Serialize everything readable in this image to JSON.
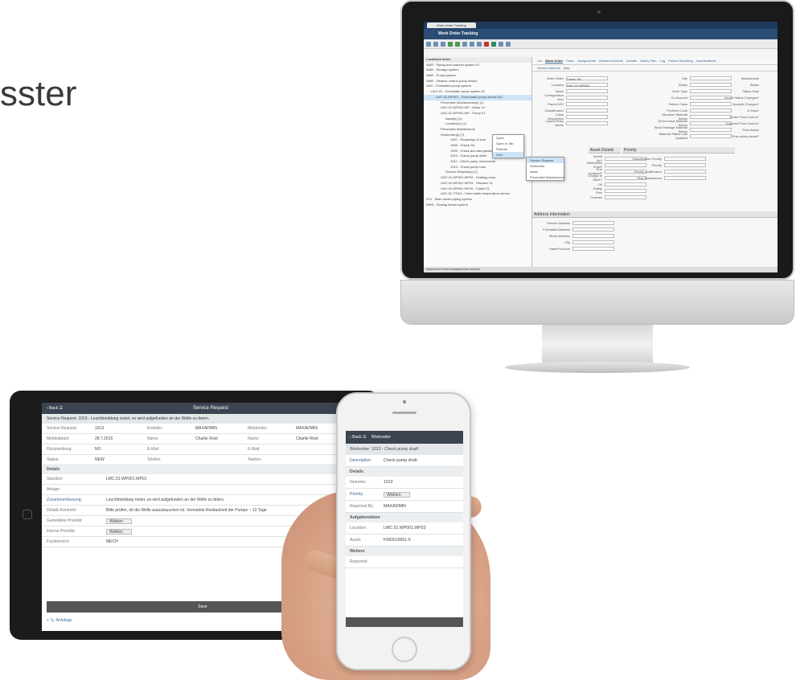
{
  "headline": "sster",
  "monitor": {
    "browser_tab": "Work Order Tracking",
    "app_title": "Work Order Tracking",
    "tree_title": "Locations Items",
    "tree_items": [
      "WAR - Piping and channel system 01",
      "WAR - Storage system",
      "WAR - Pump system",
      "WAR - Reactor control pump device",
      "LWC - Feedwater pump system",
      "LWC.01 - Feedwater pump system 01",
      "LWC.01.WP001 - Feed water pump device 001",
      "Preventive Maintenance(s) (1)",
      "LWC.01.WP001.WP - Motor 01",
      "LWC.01.WP001.WP - Pump 01",
      "Asset(s) (1)",
      "Location(s) (1)",
      "Preventive Maintenance",
      "Workorder(s) (7)",
      "1007 - Replacing oil seal",
      "1008 - Check Oil",
      "1009 - Check and add grease",
      "1010 - Check pump shaft",
      "1011 - Check pump mechanical",
      "1013 - Check pump rotor",
      "Service Request(s) (1)",
      "LWC.01.WP001.WP03 - Sealing pump",
      "LWC.01.WP001.WP04 - Gearbox 01",
      "LWC.01.WP001.WP05 - Clutch 01",
      "LWC.01.TT001 - Feed water temperature sensor",
      "LR1 - Main steam piping system",
      "RWS - Sealing steam system"
    ],
    "tabs": [
      "List",
      "Work Order",
      "Plans",
      "Assignments",
      "Related Records",
      "Actuals",
      "Safety Plan",
      "Log",
      "Failure Reporting",
      "Specifications"
    ],
    "subtabs": [
      "Service Address",
      "Map"
    ],
    "form_labels": [
      "Work Order",
      "Location",
      "Asset",
      "Configuration Item",
      "Parent WO",
      "Classification",
      "Class Description",
      "Layout Entry Name"
    ],
    "form_values": [
      "1026",
      "Check Oil",
      "LWC.01.WP001",
      "Feed pump"
    ],
    "right_labels": [
      "Site",
      "Status",
      "Work Type",
      "GL Account",
      "Failure Class",
      "Problem Code",
      "Structure Material Status",
      "Direct Issue Material Status",
      "Work Package Material Status",
      "Material Status Last Updated"
    ],
    "status_labels": [
      "Attachments",
      "Status",
      "Status Date",
      "Inherit Status Changes?",
      "Accepts Charges?",
      "Is Task?",
      "Under Flow Control?",
      "Suspend Flow Control?",
      "Flow Action",
      "Flow action Assist?"
    ],
    "context_menu": [
      "Open",
      "Open in Tab",
      "Refresh",
      "New"
    ],
    "submenu": [
      "Service Request",
      "Workorder",
      "Asset",
      "Preventive Maintenance"
    ],
    "section_asset": "Asset Details",
    "section_priority": "Priority",
    "priority_labels": [
      "Classification Priority",
      "Priority",
      "Priority Justification",
      "Risk Assessment"
    ],
    "asset_labels": [
      "Inherit Up?",
      "Warranties Exist?",
      "Run Updated?",
      "Charge to Store?",
      "Oil",
      "Safety Plan",
      "Contract"
    ],
    "section_address": "Address Information",
    "address_labels": [
      "Service Address",
      "Formatted Address",
      "Street Address",
      "City",
      "State/Province"
    ],
    "status_bar": "maximo/ui/?event=loadapp&value=wotrack"
  },
  "tablet": {
    "back": "Back",
    "title": "Service Request",
    "subtitle": "Service Request: 1013 - Leuchtmeldung rostet, es wird aufgefunden an der Welle zu feiern.",
    "rows": [
      [
        "Service Request:",
        "1013",
        "Ersteller:",
        "MAXADMIN",
        "Meldender:",
        "MAXADMIN"
      ],
      [
        "Meldedatum:",
        "28.7.2015",
        "Name:",
        "Charlie Root",
        "Name:",
        "Charlie Root"
      ],
      [
        "Rückmeldung:",
        "NO",
        "E-Mail:",
        "",
        "E-Mail:",
        ""
      ],
      [
        "Status:",
        "NEW",
        "Telefon:",
        "",
        "Telefon:",
        ""
      ]
    ],
    "details_title": "Details",
    "details": [
      [
        "Standort:",
        "LWC.01.WP001.WP01"
      ],
      [
        "Anlage:",
        ""
      ],
      [
        "Zusammenfassung:",
        "Leuchtmeldung rostet, es wird aufgefunden an der Welle zu feiern."
      ],
      [
        "Details Kontrolle:",
        "Bitte prüfen, ob die Welle auszutauschen ist. Vermutete Restlaufzeit der Pumpe ~ 12 Tage"
      ],
      [
        "Gemeldete Priorität:",
        "Wählen"
      ],
      [
        "Interne Priorität:",
        "Wählen"
      ],
      [
        "Fachbereich:",
        "MECH"
      ]
    ],
    "save": "Save",
    "attachments": "Anhänge"
  },
  "phone": {
    "back": "Back",
    "title": "Workorder",
    "subtitle": "Workorder: 1013 - Check pump shaft",
    "description_label": "Description",
    "description_value": "Check pump shaft",
    "details_title": "Details",
    "number_label": "Nummer:",
    "number_value": "1013",
    "priority_label": "Priority:",
    "priority_value": "Wählen",
    "reported_label": "Reported By:",
    "reported_value": "MAXADMIN",
    "assignment_title": "Aufgabendaten",
    "location_label": "Location:",
    "location_value": "LWC.01.WP001.WP03",
    "asset_label": "Asset:",
    "asset_value": "FWD010001-5",
    "more_title": "Weitere",
    "reported2_label": "Reported:"
  }
}
